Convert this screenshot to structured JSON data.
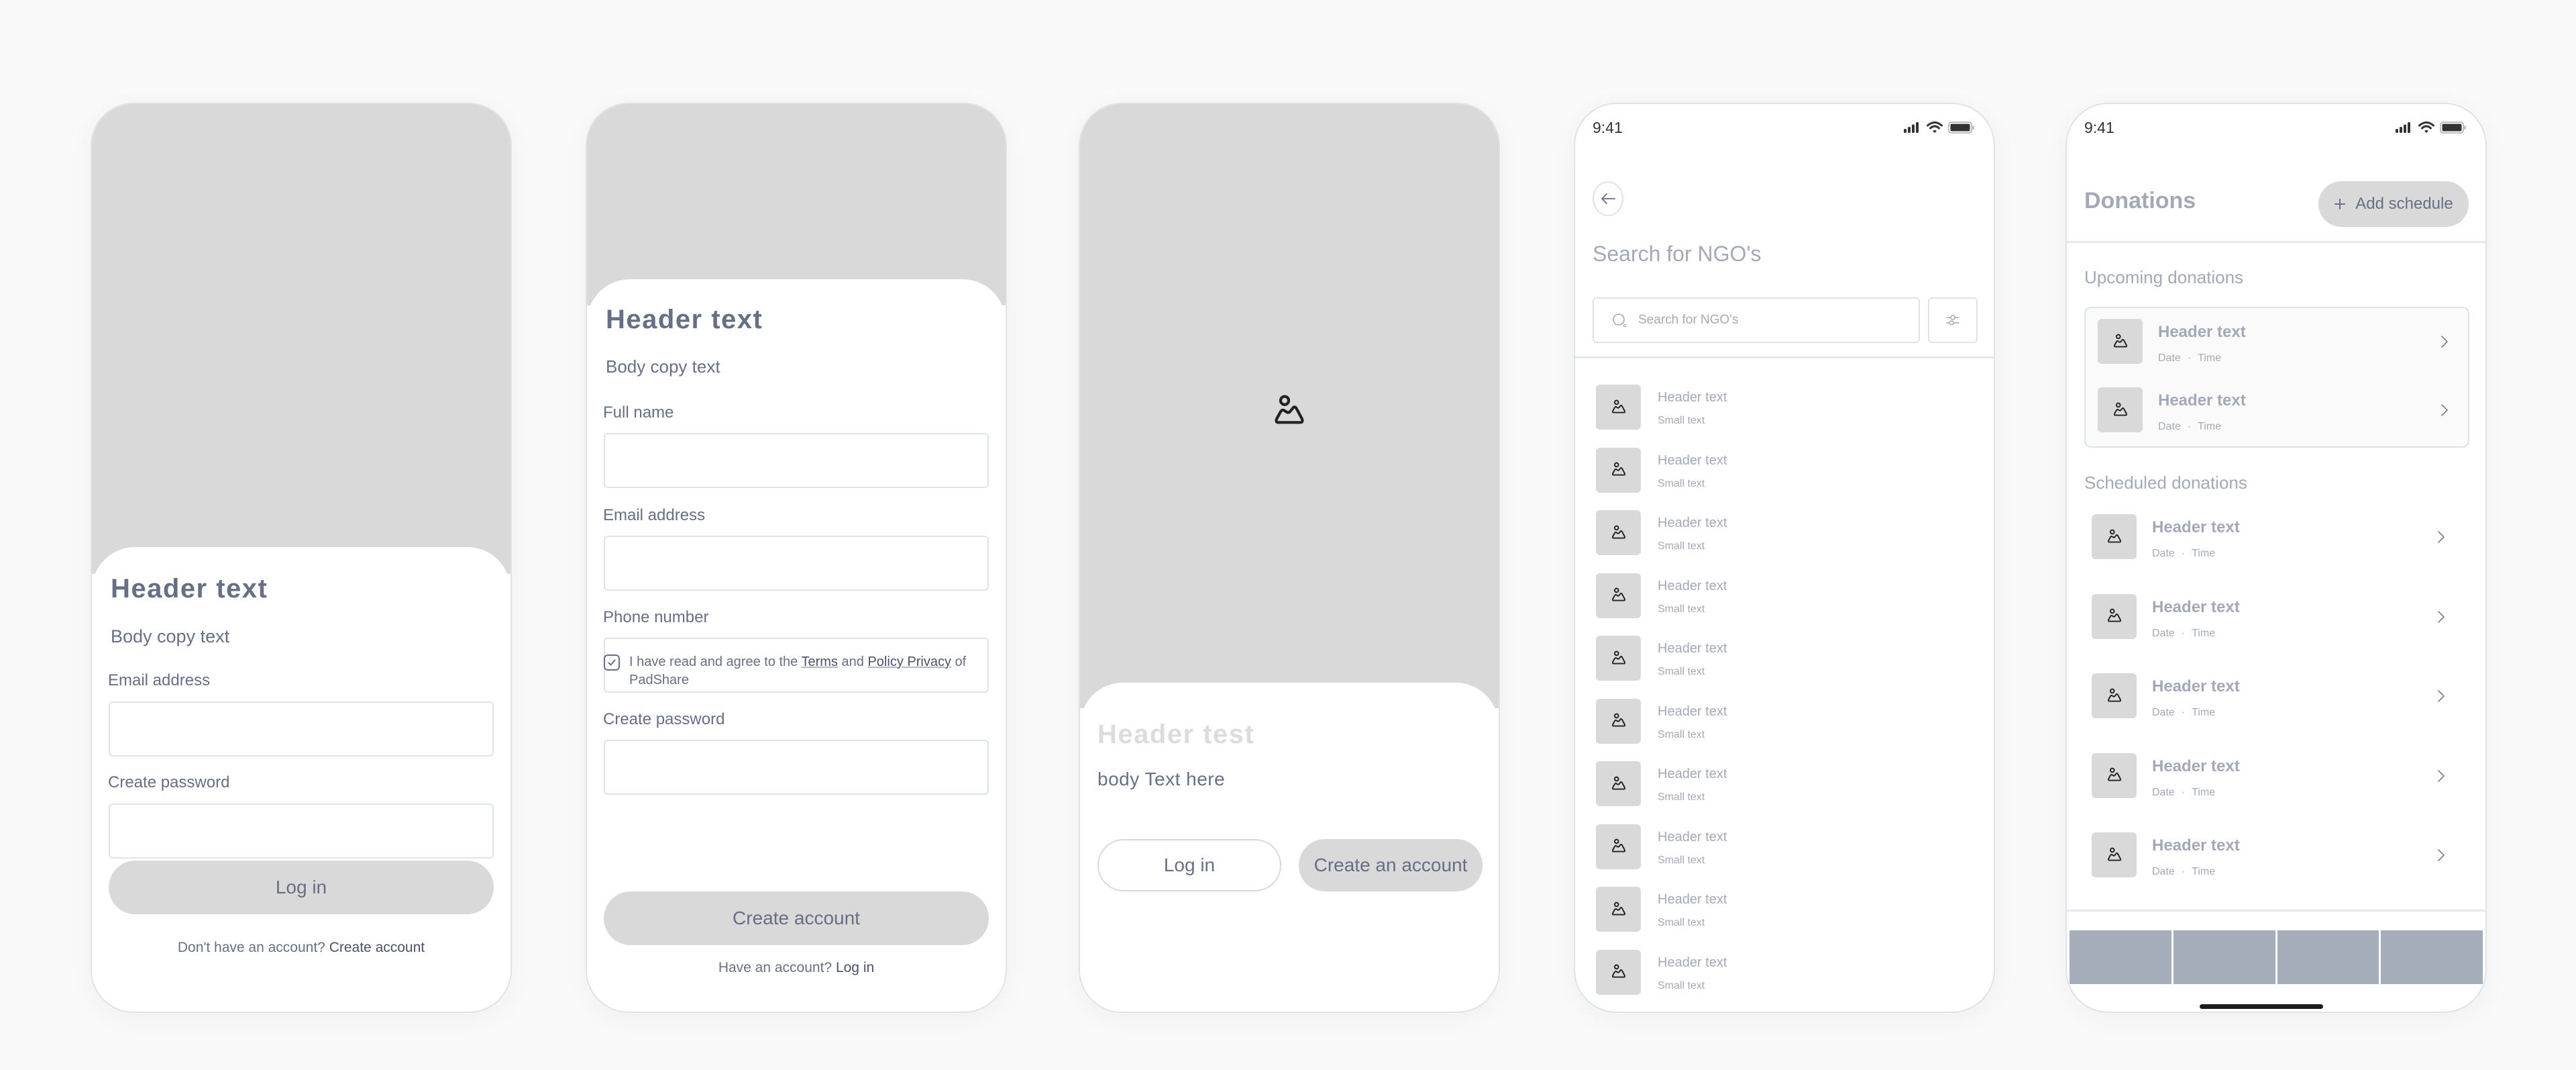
{
  "colors": {
    "background": "#f9f9f9",
    "placeholder_gray": "#d9d9d9",
    "text_primary": "#676f84",
    "text_muted": "#a3a9b7",
    "border": "#dde3ea",
    "nav_tab": "#a6adba"
  },
  "status_bar": {
    "time": "9:41",
    "icons": [
      "signal-icon",
      "wifi-icon",
      "battery-icon"
    ]
  },
  "login_screen": {
    "header": "Header text",
    "body": "Body copy text",
    "fields": [
      {
        "label": "Email address",
        "value": "",
        "placeholder": ""
      },
      {
        "label": "Create password",
        "value": "",
        "placeholder": ""
      }
    ],
    "primary_button": "Log in",
    "footer_text": "Don't have an account?",
    "footer_link": "Create account"
  },
  "signup_screen": {
    "header": "Header text",
    "body": "Body copy text",
    "fields": [
      {
        "label": "Full name",
        "value": ""
      },
      {
        "label": "Email address",
        "value": ""
      },
      {
        "label": "Phone number",
        "value": ""
      },
      {
        "label": "Create password",
        "value": ""
      }
    ],
    "agree": {
      "checked": true,
      "prefix": "I have read and agree to the",
      "terms_link": "Terms",
      "and": "and",
      "privacy_link": "Policy Privacy",
      "suffix": "of PadShare"
    },
    "primary_button": "Create account",
    "footer_text": "Have an account?",
    "footer_link": "Log in"
  },
  "welcome_screen": {
    "header": "Header test",
    "body": "body Text here",
    "login_button": "Log in",
    "create_button": "Create an account"
  },
  "search_screen": {
    "title": "Search for NGO's",
    "search_placeholder": "Search for NGO's",
    "items": [
      {
        "title": "Header text",
        "subtitle": "Small text"
      },
      {
        "title": "Header text",
        "subtitle": "Small text"
      },
      {
        "title": "Header text",
        "subtitle": "Small text"
      },
      {
        "title": "Header text",
        "subtitle": "Small text"
      },
      {
        "title": "Header text",
        "subtitle": "Small text"
      },
      {
        "title": "Header text",
        "subtitle": "Small text"
      },
      {
        "title": "Header text",
        "subtitle": "Small text"
      },
      {
        "title": "Header text",
        "subtitle": "Small text"
      },
      {
        "title": "Header text",
        "subtitle": "Small text"
      },
      {
        "title": "Header text",
        "subtitle": "Small text"
      }
    ]
  },
  "donations_screen": {
    "title": "Donations",
    "add_button": "Add schedule",
    "upcoming_title": "Upcoming donations",
    "upcoming": [
      {
        "title": "Header text",
        "date": "Date",
        "time": "Time"
      },
      {
        "title": "Header text",
        "date": "Date",
        "time": "Time"
      }
    ],
    "scheduled_title": "Scheduled donations",
    "scheduled": [
      {
        "title": "Header text",
        "date": "Date",
        "time": "Time"
      },
      {
        "title": "Header text",
        "date": "Date",
        "time": "Time"
      },
      {
        "title": "Header text",
        "date": "Date",
        "time": "Time"
      },
      {
        "title": "Header text",
        "date": "Date",
        "time": "Time"
      },
      {
        "title": "Header text",
        "date": "Date",
        "time": "Time"
      }
    ],
    "separator": "·",
    "nav_tabs": 4
  }
}
